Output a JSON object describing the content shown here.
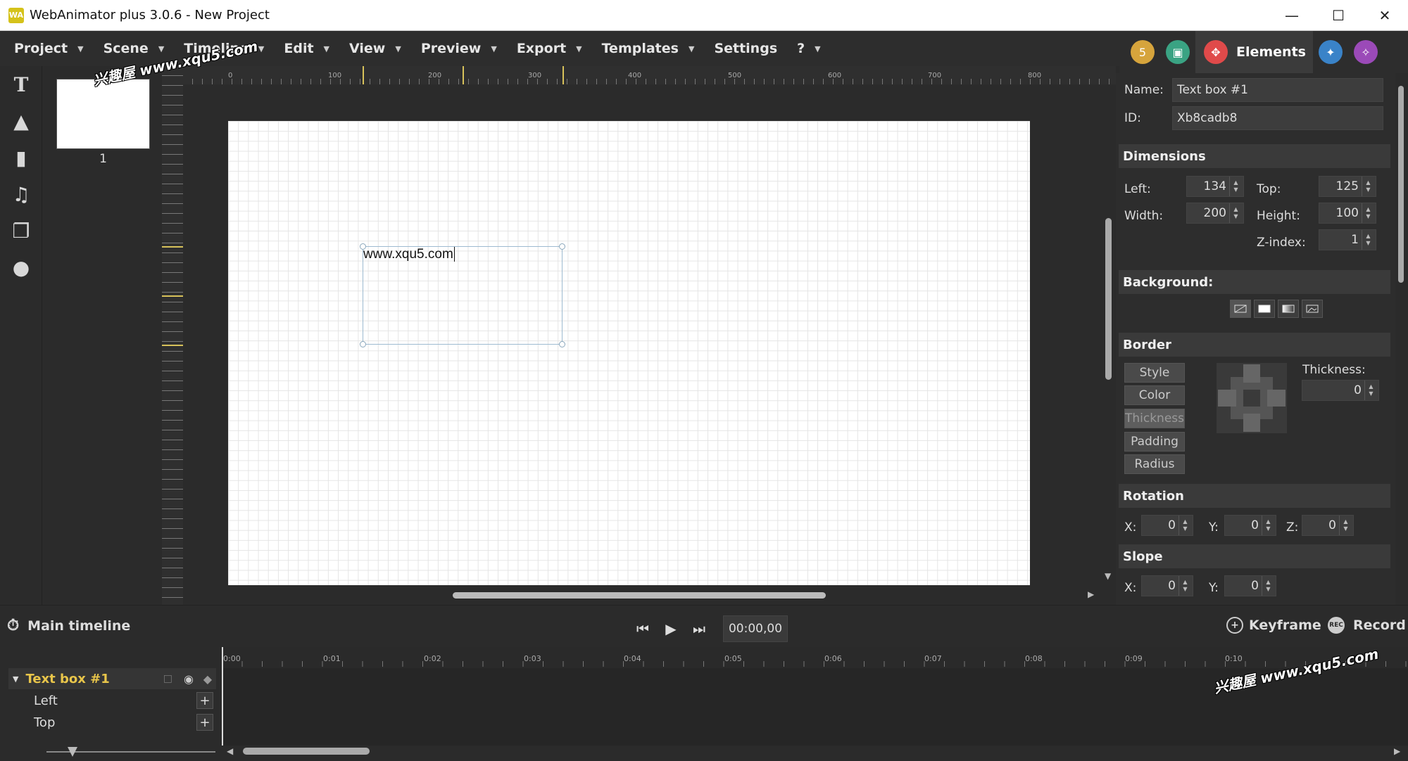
{
  "window": {
    "title": "WebAnimator plus 3.0.6 - New Project",
    "logo": "WA",
    "controls": [
      "minimize-icon",
      "maximize-icon",
      "close-icon"
    ]
  },
  "menu": [
    {
      "label": "Project"
    },
    {
      "label": "Scene"
    },
    {
      "label": "Timeline"
    },
    {
      "label": "Edit"
    },
    {
      "label": "View"
    },
    {
      "label": "Preview"
    },
    {
      "label": "Export"
    },
    {
      "label": "Templates"
    },
    {
      "label": "Settings"
    },
    {
      "label": "?"
    }
  ],
  "right_tabs": {
    "active_label": "Elements",
    "icons": [
      "html5-icon",
      "film-icon",
      "move-icon",
      "wand-icon",
      "sparkle-icon"
    ],
    "colors": {
      "html5": "#d6a43c",
      "film": "#3aa383",
      "move": "#e04a4a",
      "wand": "#3a83c8",
      "sparkle": "#9b4ab8"
    }
  },
  "tools": [
    "text-tool-icon",
    "image-tool-icon",
    "video-tool-icon",
    "audio-tool-icon",
    "layers-tool-icon",
    "shapes-tool-icon"
  ],
  "scenes": [
    {
      "number": "1"
    }
  ],
  "ruler": {
    "labels": [
      "0",
      "100",
      "200",
      "300",
      "400",
      "500",
      "600",
      "700",
      "800"
    ]
  },
  "canvas": {
    "textbox_text": "www.xqu5.com"
  },
  "properties": {
    "name_label": "Name:",
    "name_value": "Text box #1",
    "id_label": "ID:",
    "id_value": "Xb8cadb8",
    "dimensions": {
      "title": "Dimensions",
      "left_label": "Left:",
      "left": "134",
      "top_label": "Top:",
      "top": "125",
      "width_label": "Width:",
      "width": "200",
      "height_label": "Height:",
      "height": "100",
      "zindex_label": "Z-index:",
      "zindex": "1"
    },
    "background": {
      "title": "Background:"
    },
    "border": {
      "title": "Border",
      "buttons": [
        "Style",
        "Color",
        "Thickness",
        "Padding",
        "Radius"
      ],
      "active": "Thickness",
      "thickness_label": "Thickness:",
      "thickness": "0"
    },
    "rotation": {
      "title": "Rotation",
      "x_label": "X:",
      "x": "0",
      "y_label": "Y:",
      "y": "0",
      "z_label": "Z:",
      "z": "0"
    },
    "slope": {
      "title": "Slope",
      "x_label": "X:",
      "x": "0",
      "y_label": "Y:",
      "y": "0"
    }
  },
  "timeline": {
    "title": "Main timeline",
    "time": "00:00,00",
    "keyframe_label": "Keyframe",
    "record_label": "Record",
    "rec_badge": "REC",
    "ticks": [
      "0:00",
      "0:01",
      "0:02",
      "0:03",
      "0:04",
      "0:05",
      "0:06",
      "0:07",
      "0:08",
      "0:09",
      "0:10"
    ],
    "element": "Text box #1",
    "properties": [
      "Left",
      "Top"
    ]
  },
  "watermarks": [
    "兴趣屋 www.xqu5.com",
    "兴趣屋 www.xqu5.com"
  ]
}
